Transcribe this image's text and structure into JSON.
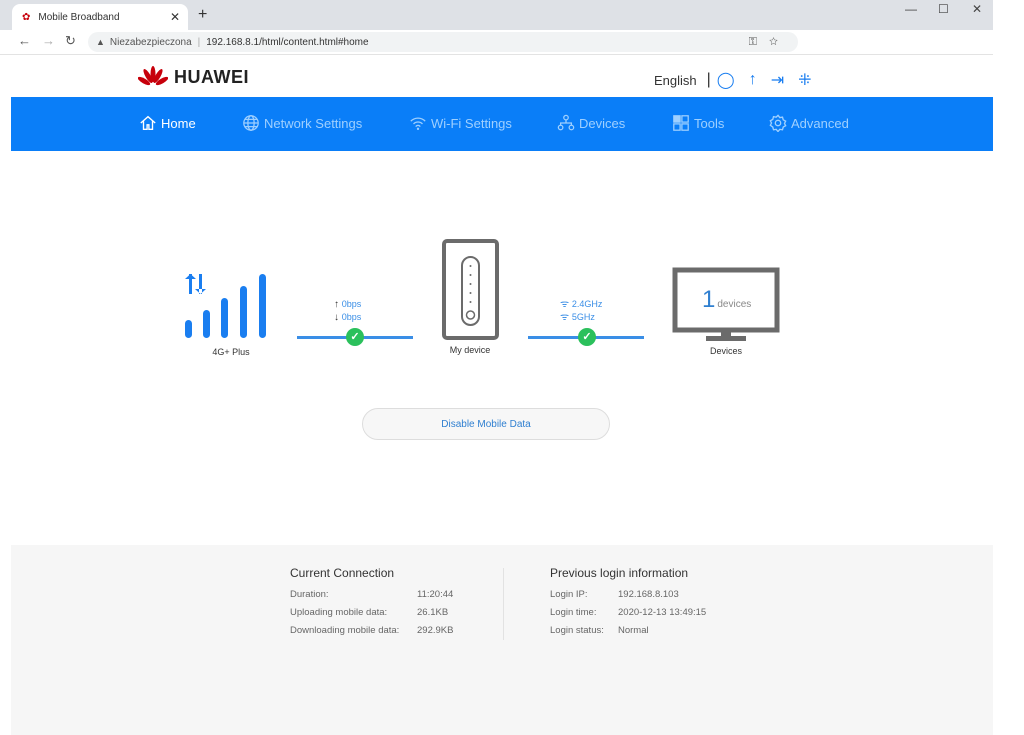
{
  "browser": {
    "tab_title": "Mobile Broadband",
    "security_label": "Niezabezpieczona",
    "url": "192.168.8.1/html/content.html#home"
  },
  "header": {
    "brand": "HUAWEI",
    "language": "English"
  },
  "nav": {
    "items": [
      {
        "label": "Home",
        "icon": "home-icon"
      },
      {
        "label": "Network Settings",
        "icon": "globe-icon"
      },
      {
        "label": "Wi-Fi Settings",
        "icon": "wifi-icon"
      },
      {
        "label": "Devices",
        "icon": "devices-icon"
      },
      {
        "label": "Tools",
        "icon": "tools-icon"
      },
      {
        "label": "Advanced",
        "icon": "gear-icon"
      }
    ]
  },
  "status": {
    "network_type": "4G+  Plus",
    "upload_rate": "0bps",
    "download_rate": "0bps",
    "device_label": "My device",
    "wifi_24": "2.4GHz",
    "wifi_5": "5GHz",
    "device_count": "1",
    "device_count_unit": "devices",
    "devices_label": "Devices",
    "signal_bars": 5,
    "colors": {
      "accent": "#0a7ef8",
      "ok": "#2bc05c"
    }
  },
  "actions": {
    "disable_mobile_data": "Disable Mobile Data"
  },
  "current_connection": {
    "title": "Current Connection",
    "rows": [
      {
        "label": "Duration:",
        "value": "11:20:44"
      },
      {
        "label": "Uploading mobile data:",
        "value": "26.1KB"
      },
      {
        "label": "Downloading mobile data:",
        "value": "292.9KB"
      }
    ]
  },
  "previous_login": {
    "title": "Previous login information",
    "rows": [
      {
        "label": "Login IP:",
        "value": "192.168.8.103"
      },
      {
        "label": "Login time:",
        "value": "2020-12-13 13:49:15"
      },
      {
        "label": "Login status:",
        "value": "Normal"
      }
    ]
  }
}
